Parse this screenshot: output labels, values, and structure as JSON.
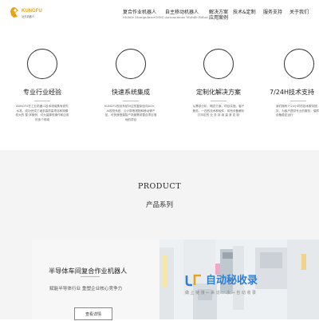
{
  "header": {
    "logo": {
      "brand": "KUNGFU",
      "sub": "功夫机器人"
    },
    "nav": [
      {
        "label": "复合作业机器人",
        "sub": "Mobile Manipulator(MM)"
      },
      {
        "label": "自主移动机器人",
        "sub": "Autonomous Mobile Robot"
      },
      {
        "label": "解决方案",
        "label2": "应用案例"
      },
      {
        "label": "技术&定制"
      },
      {
        "label": "服务支持"
      },
      {
        "label": "关于我们"
      }
    ]
  },
  "features": [
    {
      "title": "专业行业经验",
      "desc": "KUNGFU在工业机器人技术领域具有领先水准，成功完成了诸多高质量项目和规模较大的 整 体案例，可大量降低操作和应用的多个领域"
    },
    {
      "title": "快速系统集成",
      "desc": "KUNGFU现设系统对应的复制全向AGV、AI视觉系统、云计算等搭配和移动等产品，可快速搭建智产场景需求整合项目落地的项目"
    },
    {
      "title": "定制化解决方案",
      "desc": "从需求分析、概念方案、项目实施、客户服务，一四的技术和软件，将有设备解析打印定的 业 务 持 续 量 身 定 制"
    },
    {
      "title": "7/24H技术支持",
      "desc": "我们拥有7*24小时的技术服务团队，为客户提供专业的服务，保障设备稳定运行"
    }
  ],
  "product": {
    "title_en": "PRODUCT",
    "title_cn": "产品系列"
  },
  "card": {
    "title": "半导体车间复合作业机器人",
    "subtitle": "赋能半导体行业 重塑企业核心竞争力",
    "button": "查看详情"
  },
  "watermark": {
    "text": "自动秘收录",
    "sub": "做 上 链 接 ← 来 访 一 次 → 自 动 收 录"
  }
}
